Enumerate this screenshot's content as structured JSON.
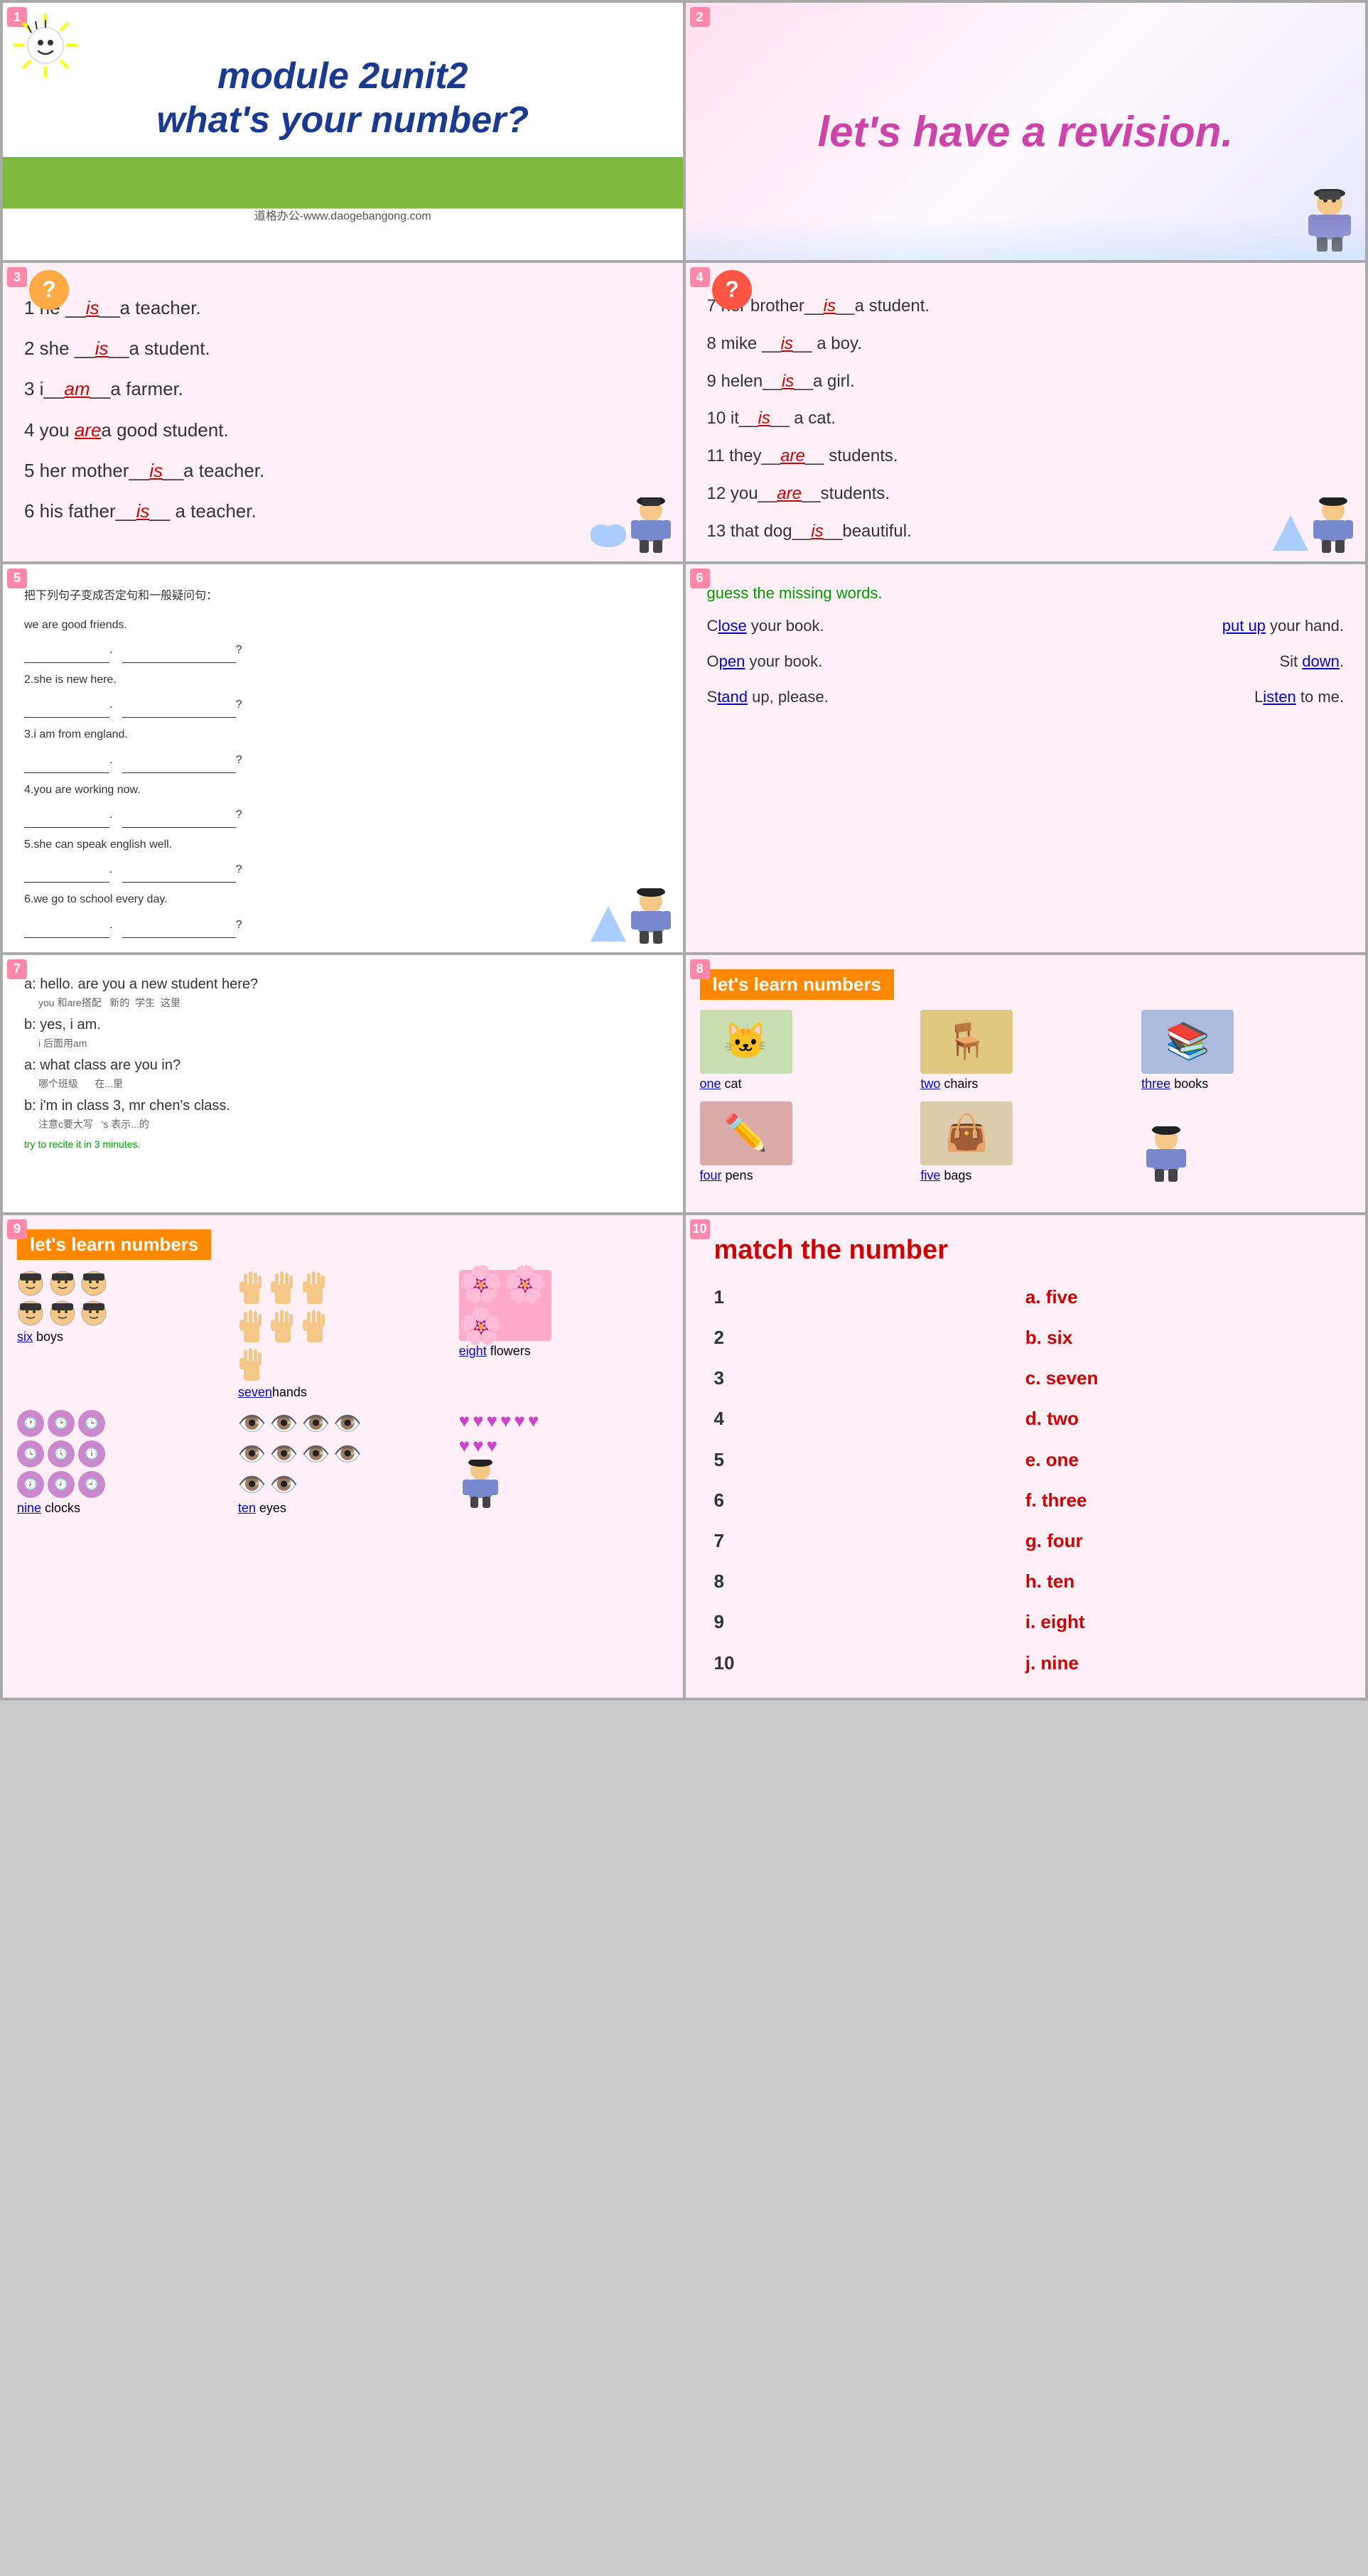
{
  "slides": {
    "slide1": {
      "num": "1",
      "title_line1": "module 2unit2",
      "title_line2": "what's your number?",
      "subtitle": "道格办公-www.daogebangong.com"
    },
    "slide2": {
      "num": "2",
      "text": "let's have a revision."
    },
    "slide3": {
      "num": "3",
      "items": [
        "1 he __is__a teacher.",
        "2 she __is__a student.",
        "3 i__am__a farmer.",
        "4 you __are__a good student.",
        "5 her mother__is__a teacher.",
        "6 his father__is__ a teacher."
      ]
    },
    "slide4": {
      "num": "4",
      "items": [
        "7 her brother__is__a student.",
        "8 mike __is__ a boy.",
        "9 helen__is__a girl.",
        "10 it__is__ a cat.",
        "11 they__are__ students.",
        "12 you__are__students.",
        "13 that dog__is__beautiful."
      ]
    },
    "slide5": {
      "num": "5",
      "instruction": "把下列句子变成否定句和一般疑问句：",
      "items": [
        {
          "text": "we are good friends.",
          "blank1": "____________.",
          "blank2": "_______________?"
        },
        {
          "text": "2.she is new here.",
          "blank1": "____________.",
          "blank2": "____________?"
        },
        {
          "text": "3.i am from england.",
          "blank1": "____________.",
          "blank2": "_______________?"
        },
        {
          "text": "4.you are working now.",
          "blank1": "____________.",
          "blank2": "___________________?"
        },
        {
          "text": "5.she can speak english well.",
          "blank1": "____________.",
          "blank2": "___________________?"
        },
        {
          "text": "6.we go to school every day.",
          "blank1": "____________.",
          "blank2": "____________?"
        }
      ]
    },
    "slide6": {
      "num": "6",
      "heading": "guess the missing words.",
      "rows": [
        {
          "word1": "C_lose_ your book.",
          "word2": "_put up_ your hand."
        },
        {
          "word1": "O_pen_ your book.",
          "word2": "Sit _down_."
        },
        {
          "word1": "S_tand_ up, please.",
          "word2": "L_isten_ to me."
        }
      ]
    },
    "slide7": {
      "num": "7",
      "dialogue": [
        {
          "line": "a: hello. are you a new student here?",
          "note": "you 和are搭配   新的  学生  这里"
        },
        {
          "line": "b: yes, i am.",
          "note": "i 后面用am"
        },
        {
          "line": "a: what class are you in?",
          "note": "哪个班级      在...里"
        },
        {
          "line": "b: i'm in class 3, mr chen's class.",
          "note": "注意c要大写   's 表示...的"
        }
      ],
      "try_note": "try to recite it in 3 minutes."
    },
    "slide8": {
      "num": "8",
      "banner": "let's learn numbers",
      "items": [
        {
          "emoji": "🐱",
          "label": "one",
          "noun": "cat"
        },
        {
          "emoji": "🪑",
          "label": "two",
          "noun": "chairs"
        },
        {
          "emoji": "📚",
          "label": "three",
          "noun": "books"
        },
        {
          "emoji": "✏️",
          "label": "four",
          "noun": "pens"
        },
        {
          "emoji": "👜",
          "label": "five",
          "noun": "bags"
        }
      ]
    },
    "slide9": {
      "num": "9",
      "banner": "let's learn numbers",
      "items": [
        {
          "emoji": "👦",
          "label": "six",
          "noun": "boys"
        },
        {
          "emoji": "✋",
          "label": "seven",
          "noun": "hands"
        },
        {
          "emoji": "🌸",
          "label": "eight",
          "noun": "flowers"
        },
        {
          "emoji": "🕐",
          "label": "nine",
          "noun": "clocks"
        },
        {
          "emoji": "👁️",
          "label": "ten",
          "noun": "eyes"
        }
      ]
    },
    "slide10": {
      "num": "10",
      "title": "match the number",
      "left": [
        "1",
        "2",
        "3",
        "4",
        "5",
        "6",
        "7",
        "8",
        "9",
        "10"
      ],
      "right": [
        "a. five",
        "b. six",
        "c. seven",
        "d. two",
        "e. one",
        "f. three",
        "g. four",
        "h. ten",
        "i. eight",
        "j. nine"
      ]
    }
  }
}
